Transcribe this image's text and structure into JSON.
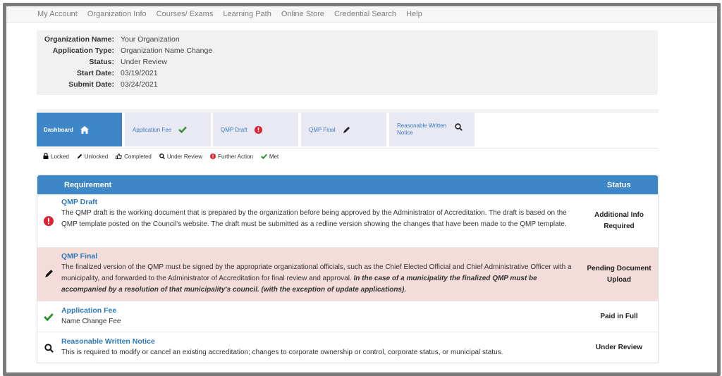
{
  "nav": [
    "My Account",
    "Organization Info",
    "Courses/ Exams",
    "Learning Path",
    "Online Store",
    "Credential Search",
    "Help"
  ],
  "info": [
    {
      "label": "Organization Name:",
      "value": "Your Organization"
    },
    {
      "label": "Application Type:",
      "value": "Organization Name Change"
    },
    {
      "label": "Status:",
      "value": "Under Review"
    },
    {
      "label": "Start Date:",
      "value": "03/19/2021"
    },
    {
      "label": "Submit Date:",
      "value": "03/24/2021"
    }
  ],
  "tabs": {
    "dashboard": "Dashboard",
    "application_fee": "Application Fee",
    "qmp_draft": "QMP Draft",
    "qmp_final": "QMP Final",
    "reasonable_notice_line1": "Reasonable Written",
    "reasonable_notice_line2": "Notice"
  },
  "legend": {
    "locked": "Locked",
    "unlocked": "Unlocked",
    "completed": "Completed",
    "under_review": "Under Review",
    "further_action": "Further Action",
    "met": "Met"
  },
  "table": {
    "col_requirement": "Requirement",
    "col_status": "Status",
    "rows": [
      {
        "title": "QMP Draft",
        "desc": "The QMP draft is the working document that is prepared by the organization before being approved by the Administrator of Accreditation. The draft is based on the QMP template posted on the Council's website. The draft must be submitted as a redline version showing the changes that have been made to the QMP template.",
        "status_line1": "Additional Info",
        "status_line2": "Required"
      },
      {
        "title": "QMP Final",
        "desc": "The finalized version of the QMP must be signed by the appropriate organizational officials, such as the Chief Elected Official and Chief Administrative Officer with a municipality, and forwarded to the Administrator of Accreditation for final review and approval.",
        "desc_emph": "In the case of a municipality the finalized QMP must be accompanied by a resolution of that municipality's council. (with the exception of update applications).",
        "status_line1": "Pending Document",
        "status_line2": "Upload"
      },
      {
        "title": "Application Fee",
        "desc": "Name Change Fee",
        "status_line1": "Paid in Full"
      },
      {
        "title": "Reasonable Written Notice",
        "desc": "This is required to modify or cancel an existing accreditation; changes to corporate ownership or control, corporate status, or municipal status.",
        "status_line1": "Under Review"
      }
    ]
  },
  "colors": {
    "accent": "#3d87c9",
    "alert": "#d9232d",
    "met": "#2f8f2f",
    "highlight_row": "#f3dcda"
  },
  "icons": [
    "home-icon",
    "check-icon",
    "alert-icon",
    "pencil-icon",
    "search-icon",
    "lock-icon",
    "thumbs-up-icon"
  ]
}
